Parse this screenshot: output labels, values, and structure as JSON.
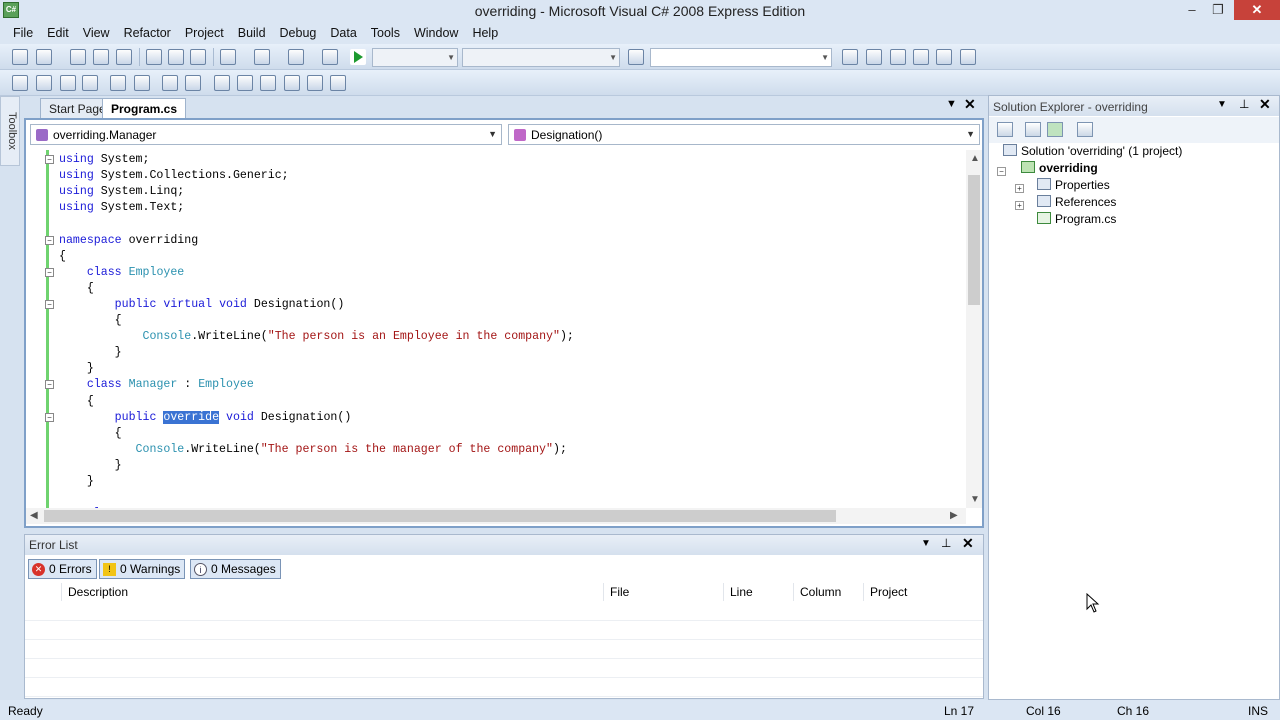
{
  "window": {
    "title": "overriding - Microsoft Visual C# 2008 Express Edition",
    "app_icon_text": "C#",
    "minimize": "–",
    "maximize": "❐",
    "close": "✕"
  },
  "menu": [
    "File",
    "Edit",
    "View",
    "Refactor",
    "Project",
    "Build",
    "Debug",
    "Data",
    "Tools",
    "Window",
    "Help"
  ],
  "toolbox": {
    "label": "Toolbox"
  },
  "editor": {
    "tabs": [
      "Start Page",
      "Program.cs"
    ],
    "active_tab": "Program.cs",
    "type_combo": "overriding.Manager",
    "member_combo": "Designation()",
    "code": [
      [
        {
          "t": "using",
          "c": "kw"
        },
        {
          "t": " System;",
          "c": ""
        }
      ],
      [
        {
          "t": "using",
          "c": "kw"
        },
        {
          "t": " System.Collections.Generic;",
          "c": ""
        }
      ],
      [
        {
          "t": "using",
          "c": "kw"
        },
        {
          "t": " System.Linq;",
          "c": ""
        }
      ],
      [
        {
          "t": "using",
          "c": "kw"
        },
        {
          "t": " System.Text;",
          "c": ""
        }
      ],
      [],
      [
        {
          "t": "namespace",
          "c": "kw"
        },
        {
          "t": " overriding",
          "c": ""
        }
      ],
      [
        {
          "t": "{",
          "c": ""
        }
      ],
      [
        {
          "t": "    ",
          "c": ""
        },
        {
          "t": "class",
          "c": "kw"
        },
        {
          "t": " ",
          "c": ""
        },
        {
          "t": "Employee",
          "c": "ty"
        }
      ],
      [
        {
          "t": "    {",
          "c": ""
        }
      ],
      [
        {
          "t": "        ",
          "c": ""
        },
        {
          "t": "public",
          "c": "kw"
        },
        {
          "t": " ",
          "c": ""
        },
        {
          "t": "virtual",
          "c": "kw"
        },
        {
          "t": " ",
          "c": ""
        },
        {
          "t": "void",
          "c": "kw"
        },
        {
          "t": " Designation()",
          "c": ""
        }
      ],
      [
        {
          "t": "        {",
          "c": ""
        }
      ],
      [
        {
          "t": "            ",
          "c": ""
        },
        {
          "t": "Console",
          "c": "ty"
        },
        {
          "t": ".WriteLine(",
          "c": ""
        },
        {
          "t": "\"The person is an Employee in the company\"",
          "c": "st"
        },
        {
          "t": ");",
          "c": ""
        }
      ],
      [
        {
          "t": "        }",
          "c": ""
        }
      ],
      [
        {
          "t": "    }",
          "c": ""
        }
      ],
      [
        {
          "t": "    ",
          "c": ""
        },
        {
          "t": "class",
          "c": "kw"
        },
        {
          "t": " ",
          "c": ""
        },
        {
          "t": "Manager",
          "c": "ty"
        },
        {
          "t": " : ",
          "c": ""
        },
        {
          "t": "Employee",
          "c": "ty"
        }
      ],
      [
        {
          "t": "    {",
          "c": ""
        }
      ],
      [
        {
          "t": "        ",
          "c": ""
        },
        {
          "t": "public",
          "c": "kw"
        },
        {
          "t": " ",
          "c": ""
        },
        {
          "t": "override",
          "c": "sel"
        },
        {
          "t": " ",
          "c": ""
        },
        {
          "t": "void",
          "c": "kw"
        },
        {
          "t": " Designation()",
          "c": ""
        }
      ],
      [
        {
          "t": "        {",
          "c": ""
        }
      ],
      [
        {
          "t": "           ",
          "c": ""
        },
        {
          "t": "Console",
          "c": "ty"
        },
        {
          "t": ".WriteLine(",
          "c": ""
        },
        {
          "t": "\"The person is the manager of the company\"",
          "c": "st"
        },
        {
          "t": ");",
          "c": ""
        }
      ],
      [
        {
          "t": "        }",
          "c": ""
        }
      ],
      [
        {
          "t": "    }",
          "c": ""
        }
      ],
      [],
      [
        {
          "t": "    ",
          "c": ""
        },
        {
          "t": "class",
          "c": "kw"
        },
        {
          "t": " ",
          "c": ""
        },
        {
          "t": "P",
          "c": "ty"
        }
      ]
    ]
  },
  "error_list": {
    "title": "Error List",
    "errors": "0 Errors",
    "warnings": "0 Warnings",
    "messages": "0 Messages",
    "columns": [
      "Description",
      "File",
      "Line",
      "Column",
      "Project"
    ]
  },
  "solution_explorer": {
    "title": "Solution Explorer - overriding",
    "solution": "Solution 'overriding' (1 project)",
    "project": "overriding",
    "items": [
      "Properties",
      "References",
      "Program.cs"
    ]
  },
  "status": {
    "ready": "Ready",
    "line": "Ln 17",
    "col": "Col 16",
    "ch": "Ch 16",
    "mode": "INS"
  },
  "colors": {
    "keyword": "#1a1ad8",
    "type": "#2b91af",
    "string": "#a31515",
    "selection": "#3a73d3"
  }
}
